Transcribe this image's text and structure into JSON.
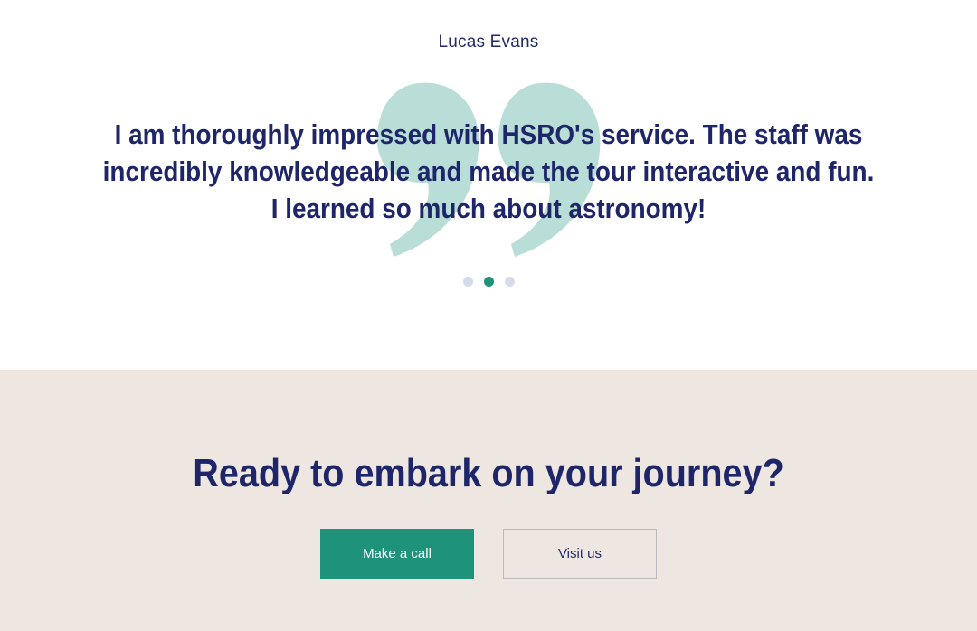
{
  "testimonial": {
    "author": "Lucas Evans",
    "quote": "I am thoroughly impressed with HSRO's service. The staff was incredibly knowledgeable and made the tour interactive and fun. I learned so much about astronomy!",
    "quote_icon": "quote-mark-icon",
    "carousel": {
      "total_slides": 3,
      "active_slide": 2
    }
  },
  "cta": {
    "title": "Ready to embark on your journey?",
    "primary_button": "Make a call",
    "secondary_button": "Visit us"
  },
  "colors": {
    "navy": "#1e2669",
    "accent_green": "#1e937a",
    "quote_mark": "#b9ded8",
    "dot_inactive": "#d6dbe8",
    "cta_background": "#ede6e1"
  }
}
